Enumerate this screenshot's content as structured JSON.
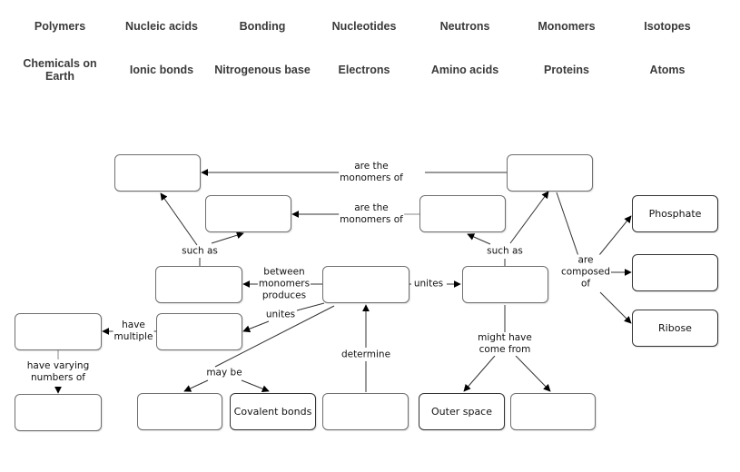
{
  "word_bank": [
    [
      "Polymers",
      "Nucleic acids",
      "Bonding",
      "Nucleotides",
      "Neutrons",
      "Monomers",
      "Isotopes"
    ],
    [
      "Chemicals on Earth",
      "Ionic bonds",
      "Nitrogenous base",
      "Electrons",
      "Amino acids",
      "Proteins",
      "Atoms"
    ]
  ],
  "nodes": {
    "top_left": "",
    "second_left": "",
    "top_right": "",
    "second_right": "",
    "phosphate": "Phosphate",
    "middle_right_blank": "",
    "ribose": "Ribose",
    "mid_left": "",
    "center": "",
    "mid_right": "",
    "far_left": "",
    "lower_left": "",
    "bottom_far_left": "",
    "bottom_blank_1": "",
    "covalent_bonds": "Covalent bonds",
    "bottom_center": "",
    "outer_space": "Outer space",
    "bottom_right_blank": ""
  },
  "link_labels": {
    "are_monomers_top": "are the\nmonomers of",
    "are_monomers_second": "are the\nmonomers of",
    "such_as_left": "such as",
    "such_as_right": "such as",
    "are_composed_of": "are\ncomposed\nof",
    "between_monomers": "between\nmonomers\nproduces",
    "unites_right": "unites",
    "unites_left": "unites",
    "have_multiple": "have\nmultiple",
    "have_varying": "have varying\nnumbers of",
    "may_be": "may be",
    "determine": "determine",
    "might_have": "might have\ncome from"
  }
}
